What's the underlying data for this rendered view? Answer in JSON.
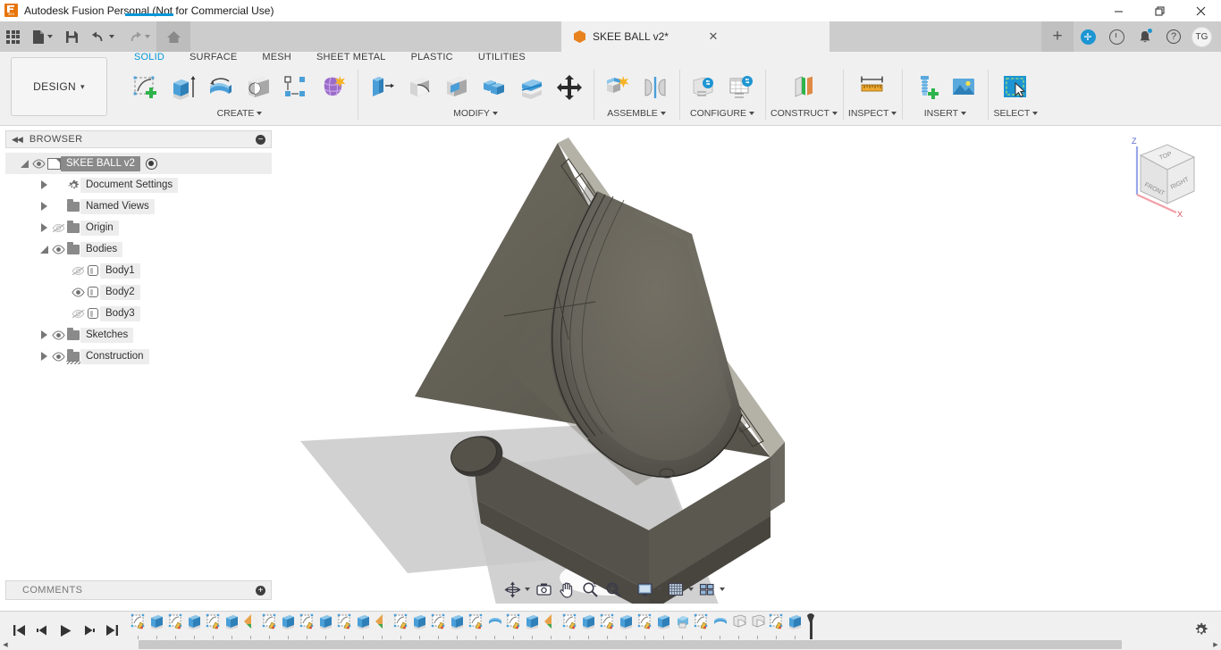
{
  "window": {
    "title": "Autodesk Fusion Personal (Not for Commercial Use)",
    "minimize": "—",
    "maximize": "❐",
    "close": "✕"
  },
  "quick_access": {
    "apps_grid": "apps-grid",
    "new": "new-document",
    "save": "save",
    "undo": "undo",
    "redo": "redo",
    "home": "home"
  },
  "document_tab": {
    "label": "SKEE BALL v2*",
    "close": "✕",
    "new_tab": "+"
  },
  "tab_right_icons": {
    "extensions": "✛",
    "job_status": "job-status",
    "notifications": "notifications",
    "help": "?",
    "avatar": "TG"
  },
  "ribbon": {
    "workspace": "DESIGN",
    "workspace_caret": "▾",
    "tabs": [
      {
        "label": "SOLID",
        "active": true
      },
      {
        "label": "SURFACE",
        "active": false
      },
      {
        "label": "MESH",
        "active": false
      },
      {
        "label": "SHEET METAL",
        "active": false
      },
      {
        "label": "PLASTIC",
        "active": false
      },
      {
        "label": "UTILITIES",
        "active": false
      }
    ],
    "panels": [
      {
        "label": "CREATE",
        "has_caret": true,
        "tools": [
          "create-sketch-icon",
          "extrude-icon",
          "revolve-icon",
          "hole-icon",
          "pattern-icon",
          "form-icon"
        ]
      },
      {
        "label": "MODIFY",
        "has_caret": true,
        "tools": [
          "press-pull-icon",
          "fillet-icon",
          "shell-icon",
          "combine-icon",
          "offset-face-icon",
          "move-copy-icon"
        ]
      },
      {
        "label": "ASSEMBLE",
        "has_caret": true,
        "tools": [
          "new-component-icon",
          "joint-icon"
        ]
      },
      {
        "label": "CONFIGURE",
        "has_caret": true,
        "tools": [
          "configure-design-icon",
          "configuration-table-icon"
        ]
      },
      {
        "label": "CONSTRUCT",
        "has_caret": true,
        "tools": [
          "offset-plane-icon"
        ]
      },
      {
        "label": "INSPECT",
        "has_caret": true,
        "tools": [
          "measure-icon"
        ]
      },
      {
        "label": "INSERT",
        "has_caret": true,
        "tools": [
          "insert-mcmaster-icon",
          "insert-canvas-icon"
        ]
      },
      {
        "label": "SELECT",
        "has_caret": true,
        "tools": [
          "select-window-icon"
        ]
      }
    ]
  },
  "browser": {
    "title": "BROWSER",
    "collapse": "◀◀",
    "minus": "−",
    "tree": [
      {
        "label": "SKEE BALL v2",
        "indent": 0,
        "expander": "down",
        "eye": "visible",
        "icon": "component-icon",
        "selected": true,
        "radio": true
      },
      {
        "label": "Document Settings",
        "indent": 1,
        "expander": "right",
        "eye": "none",
        "icon": "gear-icon",
        "selected": false,
        "radio": false
      },
      {
        "label": "Named Views",
        "indent": 1,
        "expander": "right",
        "eye": "none",
        "icon": "folder-icon",
        "selected": false,
        "radio": false
      },
      {
        "label": "Origin",
        "indent": 1,
        "expander": "right",
        "eye": "hidden",
        "icon": "folder-icon",
        "selected": false,
        "radio": false
      },
      {
        "label": "Bodies",
        "indent": 1,
        "expander": "down",
        "eye": "visible",
        "icon": "folder-icon",
        "selected": false,
        "radio": false
      },
      {
        "label": "Body1",
        "indent": 2,
        "expander": "none",
        "eye": "hidden",
        "icon": "body-icon",
        "selected": false,
        "radio": false
      },
      {
        "label": "Body2",
        "indent": 2,
        "expander": "none",
        "eye": "visible",
        "icon": "body-icon",
        "selected": false,
        "radio": false
      },
      {
        "label": "Body3",
        "indent": 2,
        "expander": "none",
        "eye": "hidden",
        "icon": "body-icon",
        "selected": false,
        "radio": false
      },
      {
        "label": "Sketches",
        "indent": 1,
        "expander": "right",
        "eye": "visible",
        "icon": "folder-icon",
        "selected": false,
        "radio": false
      },
      {
        "label": "Construction",
        "indent": 1,
        "expander": "right",
        "eye": "visible",
        "icon": "construction-folder-icon",
        "selected": false,
        "radio": false
      }
    ]
  },
  "comments": {
    "title": "COMMENTS",
    "plus": "+"
  },
  "viewcube": {
    "top_face": "TOP",
    "front_face": "FRONT",
    "right_face": "RIGHT",
    "axis_z": "Z",
    "axis_x": "X"
  },
  "navbar": {
    "items": [
      {
        "name": "orbit-icon",
        "caret": true
      },
      {
        "name": "look-at-icon",
        "caret": false
      },
      {
        "name": "pan-icon",
        "caret": false
      },
      {
        "name": "zoom-icon",
        "caret": false
      },
      {
        "name": "fit-icon",
        "caret": true
      },
      {
        "name": "display-settings-icon",
        "caret": true
      },
      {
        "name": "grid-snaps-icon",
        "caret": true
      },
      {
        "name": "viewports-icon",
        "caret": true
      }
    ]
  },
  "timeline": {
    "playback": [
      "jump-to-beginning-icon",
      "step-back-icon",
      "play-icon",
      "step-forward-icon",
      "jump-to-end-icon"
    ],
    "features": [
      "sketch",
      "extrude",
      "sketch",
      "extrude",
      "sketch",
      "extrude",
      "fillet",
      "sketch",
      "extrude",
      "sketch",
      "extrude",
      "sketch",
      "extrude",
      "fillet",
      "sketch",
      "extrude",
      "sketch",
      "extrude",
      "sketch",
      "revolve",
      "sketch",
      "extrude",
      "fillet",
      "sketch",
      "extrude",
      "sketch",
      "extrude",
      "sketch",
      "extrude",
      "shell",
      "sketch",
      "revolve",
      "fillet-round",
      "fillet-round",
      "sketch",
      "extrude"
    ],
    "settings": "timeline-settings-gear-icon"
  },
  "scrollbar": {
    "left_arrow": "◀",
    "right_arrow": "▶"
  },
  "colors": {
    "accent": "#0696d7",
    "brand_orange": "#e8750a",
    "ribbon_bg": "#f0f0f0",
    "tabstrip_bg": "#cccccc",
    "model_body": "#5f5b50",
    "model_shadow": "#c9c9c9"
  }
}
